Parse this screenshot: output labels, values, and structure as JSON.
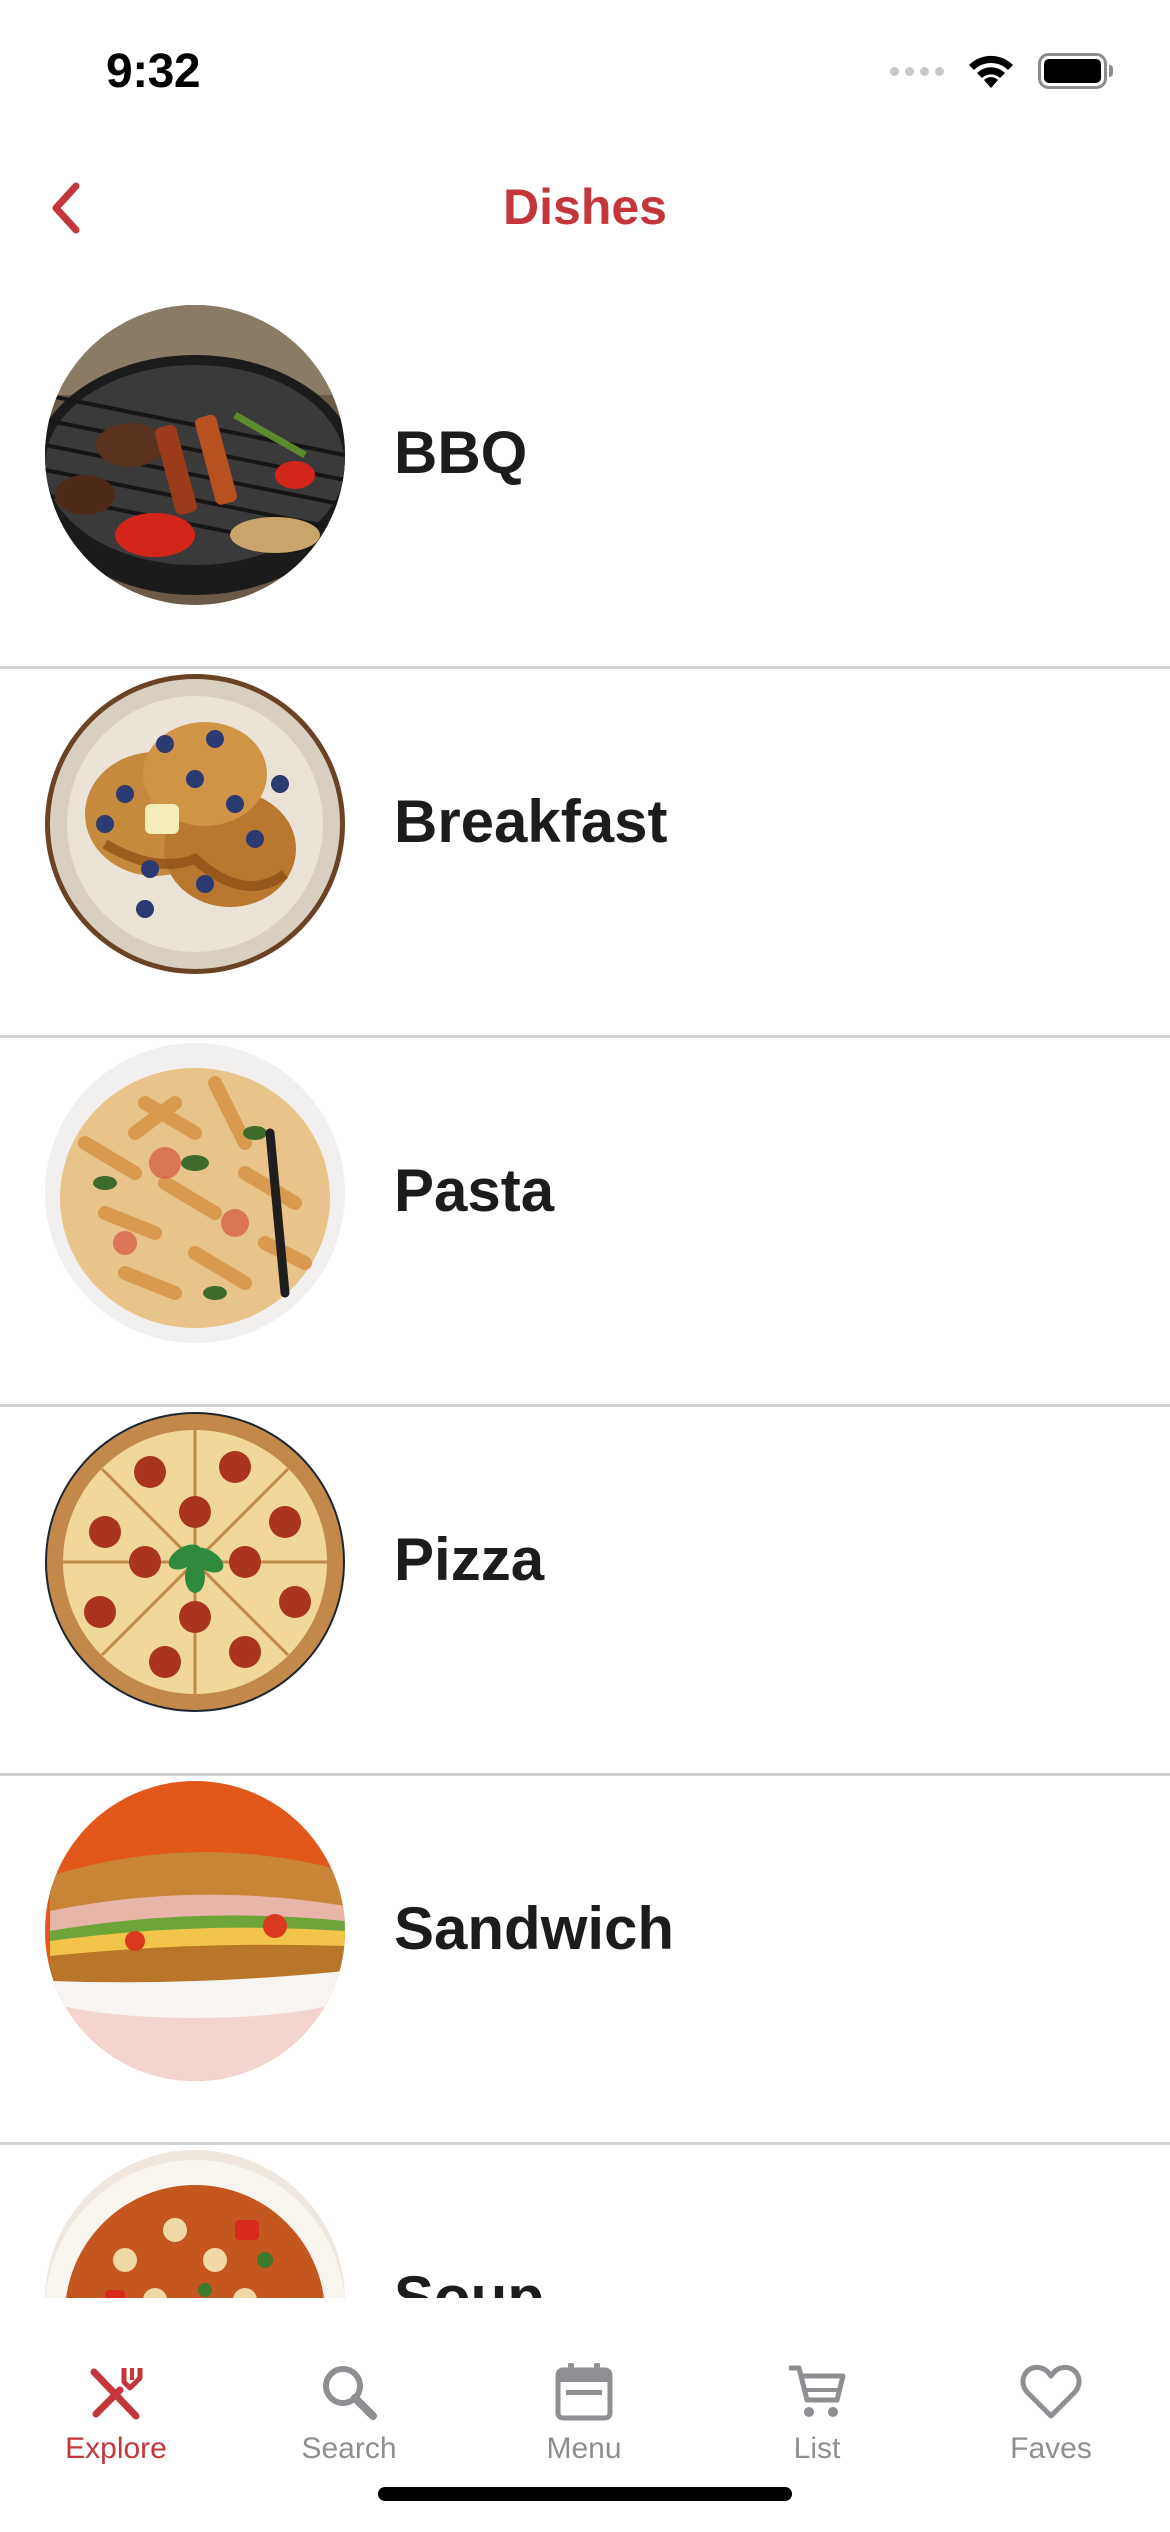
{
  "status_bar": {
    "time": "9:32"
  },
  "nav": {
    "title": "Dishes",
    "back_icon": "chevron-left-icon"
  },
  "dishes": [
    {
      "name": "BBQ",
      "image": "bbq-grill-photo"
    },
    {
      "name": "Breakfast",
      "image": "pancakes-photo"
    },
    {
      "name": "Pasta",
      "image": "penne-pasta-photo"
    },
    {
      "name": "Pizza",
      "image": "pepperoni-pizza-photo"
    },
    {
      "name": "Sandwich",
      "image": "sub-sandwich-photo"
    },
    {
      "name": "Soup",
      "image": "minestrone-soup-photo"
    }
  ],
  "tab_bar": {
    "tabs": [
      {
        "label": "Explore",
        "icon": "fork-knife-icon",
        "active": true
      },
      {
        "label": "Search",
        "icon": "search-icon",
        "active": false
      },
      {
        "label": "Menu",
        "icon": "calendar-icon",
        "active": false
      },
      {
        "label": "List",
        "icon": "cart-icon",
        "active": false
      },
      {
        "label": "Faves",
        "icon": "heart-icon",
        "active": false
      }
    ]
  },
  "colors": {
    "accent": "#c4363a",
    "inactive": "#8e8e93",
    "separator": "#d1d1d6",
    "text": "#1c1c1e"
  }
}
